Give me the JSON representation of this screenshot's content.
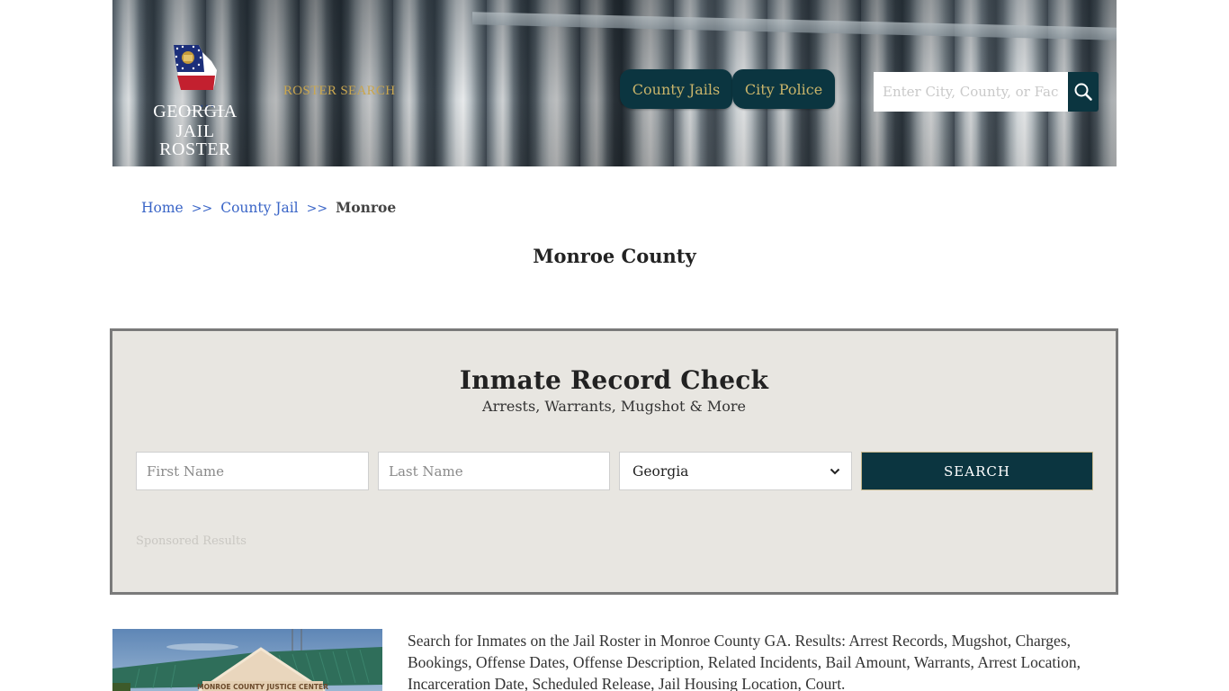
{
  "header": {
    "logo": {
      "line1": "GEORGIA",
      "line2": "JAIL ROSTER",
      "icon": "georgia-state-flag-map-icon"
    },
    "roster_search_label": "ROSTER SEARCH",
    "nav": [
      {
        "label": "County Jails"
      },
      {
        "label": "City Police"
      }
    ],
    "search": {
      "placeholder": "Enter City, County, or Facility",
      "value": "",
      "icon": "search-icon"
    },
    "colors": {
      "nav_bg": "#0b3540",
      "nav_text": "#c9b46a",
      "roster_search_text": "#c9a64f"
    }
  },
  "breadcrumb": {
    "items": [
      {
        "label": "Home"
      },
      {
        "label": "County Jail"
      }
    ],
    "separator": ">>",
    "current": "Monroe"
  },
  "page_title": "Monroe County",
  "record_check": {
    "title": "Inmate Record Check",
    "subtitle": "Arrests, Warrants, Mugshot & More",
    "first_name": {
      "placeholder": "First Name",
      "value": ""
    },
    "last_name": {
      "placeholder": "Last Name",
      "value": ""
    },
    "state_select": {
      "selected": "Georgia",
      "icon": "chevron-down-icon"
    },
    "search_button": "SEARCH",
    "sponsored_label": "Sponsored Results",
    "colors": {
      "box_bg": "#e8e6e1",
      "button_bg": "#0b3540"
    }
  },
  "content": {
    "photo_sign_text": "MONROE COUNTY JUSTICE CENTER",
    "description": "Search for Inmates on the Jail Roster in Monroe County GA. Results: Arrest Records, Mugshot, Charges, Bookings, Offense Dates, Offense Description, Related Incidents, Bail Amount, Warrants, Arrest Location, Incarceration Date, Scheduled Release, Jail Housing Location, Court."
  }
}
